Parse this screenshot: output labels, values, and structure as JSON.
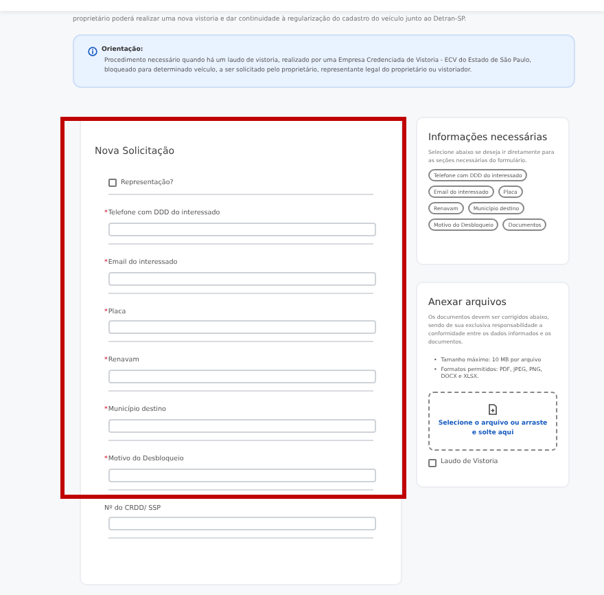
{
  "intro": "proprietário poderá realizar uma nova vistoria e dar continuidade à regularização do cadastro do veículo junto ao Detran-SP.",
  "notice": {
    "title": "Orientação:",
    "text": "Procedimento necessário quando há um laudo de vistoria, realizado por uma Empresa Credenciada de Vistoria - ECV do Estado de São Paulo, bloqueado para determinado veículo, a ser solicitado pelo proprietário, representante legal do proprietário ou vistoriador."
  },
  "form": {
    "title": "Nova Solicitação",
    "representation": {
      "label": "Representação?",
      "checked": false
    },
    "fields": [
      {
        "label": "Telefone com DDD do interessado",
        "required_mark": "*"
      },
      {
        "label": "Email do interessado",
        "required_mark": "*"
      },
      {
        "label": "Placa",
        "required_mark": "*"
      },
      {
        "label": "Renavam",
        "required_mark": "*"
      },
      {
        "label": "Município destino",
        "required_mark": "*"
      },
      {
        "label": "Motivo do Desbloqueio",
        "required_mark": "*"
      },
      {
        "label": "Nº do CRDD/ SSP"
      }
    ],
    "highlighted": true
  },
  "info": {
    "title": "Informações necessárias",
    "text": "Selecione abaixo se deseja ir diretamente para as seções necessárias do formulário.",
    "chips": [
      [
        "Telefone com DDD do interessado"
      ],
      [
        "Email do interessado",
        "Placa"
      ],
      [
        "Renavam",
        "Município destino"
      ],
      [
        "Motivo do Desbloqueio",
        "Documentos"
      ]
    ]
  },
  "attach": {
    "title": "Anexar arquivos",
    "text": "Os documentos devem ser corrigidos abaixo, sendo de sua exclusiva responsabilidade a conformidade entre os dados informados e os documentos.",
    "rules": [
      {
        "bullet": "•",
        "text": "Tamanho máximo: 10 MB por arquivo"
      },
      {
        "bullet": "•",
        "text": "Formatos permitidos: PDF, JPEG, PNG, DOCX e XLSX."
      }
    ],
    "drop": "Selecione o arquivo ou arraste e solte aqui",
    "option": {
      "label": "Laudo de Vistoria",
      "checked": false
    }
  }
}
